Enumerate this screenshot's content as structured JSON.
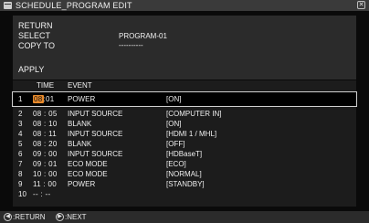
{
  "window": {
    "title": "SCHEDULE_PROGRAM EDIT",
    "close_glyph": "✕"
  },
  "top_panel": {
    "return_label": "RETURN",
    "select_label": "SELECT",
    "select_value": "PROGRAM-01",
    "copy_to_label": "COPY TO",
    "copy_to_value": "----------",
    "apply_label": "APPLY"
  },
  "table": {
    "headers": {
      "time": "TIME",
      "event": "EVENT"
    },
    "rows": [
      {
        "num": "1",
        "hour": "08",
        "minute": ":01",
        "event": "POWER",
        "value": "[ON]"
      },
      {
        "num": "2",
        "time": "08 : 05",
        "event": "INPUT SOURCE",
        "value": "[COMPUTER IN]"
      },
      {
        "num": "3",
        "time": "08 : 10",
        "event": "BLANK",
        "value": "[ON]"
      },
      {
        "num": "4",
        "time": "08 : 11",
        "event": "INPUT SOURCE",
        "value": "[HDMI 1 / MHL]"
      },
      {
        "num": "5",
        "time": "08 : 20",
        "event": "BLANK",
        "value": "[OFF]"
      },
      {
        "num": "6",
        "time": "09 : 00",
        "event": "INPUT SOURCE",
        "value": "[HDBaseT]"
      },
      {
        "num": "7",
        "time": "09 : 01",
        "event": "ECO MODE",
        "value": "[ECO]"
      },
      {
        "num": "8",
        "time": "10 : 00",
        "event": "ECO MODE",
        "value": "[NORMAL]"
      },
      {
        "num": "9",
        "time": "11 : 00",
        "event": "POWER",
        "value": "[STANDBY]"
      },
      {
        "num": "10",
        "time": "-- : --",
        "event": "",
        "value": ""
      }
    ]
  },
  "bottom_bar": {
    "return_key_glyph": "◀",
    "return_label": ":RETURN",
    "next_key_glyph": "▶",
    "next_label": ":NEXT"
  },
  "colors": {
    "highlight": "#e98a2b",
    "panel": "#2b2b2b",
    "background": "#0a0a0a"
  }
}
